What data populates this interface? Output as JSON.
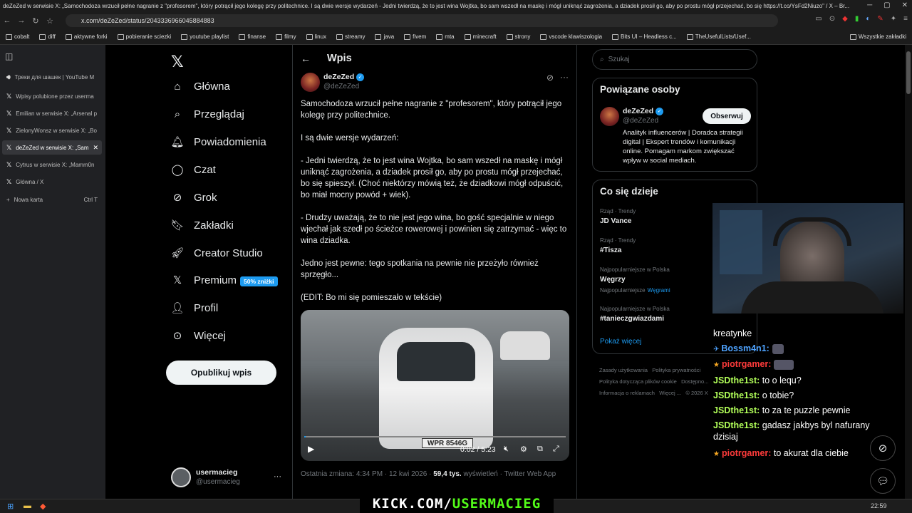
{
  "window": {
    "title": "deZeZed w serwisie X: „Samochodoza wrzucił pełne nagranie z \"profesorem\", który potrącił jego kolegę przy politechnice. I są dwie wersje wydarzeń - Jedni twierdzą, że to jest wina Wojtka, bo sam wszedł na maskę i mógł uniknąć zagrożenia, a dziadek prosił go, aby po prostu mógł przejechać, bo się https://t.co/YsFd2Niuzo\" / X – Br..."
  },
  "browser": {
    "url": "x.com/deZeZed/status/2043336966045884883"
  },
  "bookmarks": [
    "cobalt",
    "diff",
    "aktywne forki",
    "pobieranie sciezki",
    "youtube playlist",
    "finanse",
    "filmy",
    "linux",
    "streamy",
    "java",
    "fivem",
    "mta",
    "minecraft",
    "strony",
    "vscode klawiszologia",
    "Bits UI – Headless c...",
    "TheUsefulLists/Usef...",
    "Wszystkie zakładki"
  ],
  "tabs": [
    {
      "label": "Треки для шашек | YouTube M",
      "icon": "speaker-icon"
    },
    {
      "label": "Wpisy polubione przez userma",
      "icon": "x-logo"
    },
    {
      "label": "Emilian w serwisie X: „Arsenal p",
      "icon": "x-logo"
    },
    {
      "label": "ZielonyWonsz w serwisie X: „Bo",
      "icon": "x-logo"
    },
    {
      "label": "deZeZed w serwisie X: „Sam",
      "icon": "x-logo",
      "active": true
    },
    {
      "label": "Cytrus w serwisie X: „Mamm0n",
      "icon": "x-logo"
    },
    {
      "label": "Główna / X",
      "icon": "x-logo"
    }
  ],
  "new_tab": {
    "label": "Nowa karta",
    "shortcut": "Ctrl T"
  },
  "nav": [
    {
      "label": "Główna",
      "icon": "home-icon"
    },
    {
      "label": "Przeglądaj",
      "icon": "search-icon"
    },
    {
      "label": "Powiadomienia",
      "icon": "bell-icon"
    },
    {
      "label": "Czat",
      "icon": "chat-icon"
    },
    {
      "label": "Grok",
      "icon": "grok-icon"
    },
    {
      "label": "Zakładki",
      "icon": "bookmark-icon"
    },
    {
      "label": "Creator Studio",
      "icon": "rocket-icon"
    },
    {
      "label": "Premium",
      "icon": "x-logo"
    },
    {
      "label": "Profil",
      "icon": "person-icon"
    },
    {
      "label": "Więcej",
      "icon": "more-icon"
    }
  ],
  "premium_badge": "50% zniżki",
  "post_button": "Opublikuj wpis",
  "account": {
    "name": "usermacieg",
    "handle": "@usermacieg"
  },
  "header": {
    "title": "Wpis"
  },
  "post": {
    "author": "deZeZed",
    "handle": "@deZeZed",
    "paragraphs": [
      "Samochodoza wrzucił pełne nagranie z \"profesorem\", który potrącił jego kolegę przy politechnice.",
      "I są dwie wersje wydarzeń:",
      "- Jedni twierdzą, że to jest wina Wojtka, bo sam wszedł na maskę i mógł uniknąć zagrożenia, a dziadek prosił go, aby po prostu mógł przejechać, bo się spieszył. (Choć niektórzy mówią też, że dziadkowi mógł odpuścić, bo miał mocny powód + wiek).",
      "- Drudzy uważają, że to nie jest jego wina, bo gość specjalnie w niego wjechał jak szedł po ścieżce rowerowej i powinien się zatrzymać - więc to wina dziadka.",
      "Jedno jest pewne: tego spotkania na pewnie nie przeżyło również sprzęgło...",
      "(EDIT: Bo mi się pomieszało w tekście)"
    ],
    "video_time": "0:02 / 5:23",
    "plate": "WPR 8546G",
    "meta_prefix": "Ostatnia zmiana: 4:34 PM · 12 kwi 2026 · ",
    "views": "59,4 tys.",
    "meta_suffix": " wyświetleń · Twitter Web App"
  },
  "search": {
    "placeholder": "Szukaj"
  },
  "related": {
    "title": "Powiązane osoby",
    "name": "deZeZed",
    "handle": "@deZeZed",
    "follow": "Obserwuj",
    "bio": "Analityk influencerów | Doradca strategii digital | Ekspert trendów i komunikacji online. Pomagam markom zwiększać wpływ w social mediach."
  },
  "trends": {
    "title": "Co się dzieje",
    "items": [
      {
        "context": "Rząd · Trendy",
        "name": "JD Vance"
      },
      {
        "context": "Rząd · Trendy",
        "name": "#Tisza"
      },
      {
        "context": "Najpopularniejsze w Polska",
        "name": "Węgrzy",
        "extra_prefix": "Najpopularniejsze",
        "extra_link": "Węgrami"
      },
      {
        "context": "Najpopularniejsze w Polska",
        "name": "#tanieczgwiazdami"
      }
    ],
    "more": "Pokaż więcej"
  },
  "footer": [
    "Zasady użytkowania",
    "Polityka prywatności",
    "Polityka dotycząca plików cookie",
    "Dostępno...",
    "Informacja o reklamach",
    "Więcej ...",
    "© 2026 X"
  ],
  "chat": [
    {
      "user": "",
      "msg": "kreatynke",
      "color": "white"
    },
    {
      "user": "Bossm4n1:",
      "msg": "",
      "color": "blue",
      "badge": "✈"
    },
    {
      "user": "piotrgamer:",
      "msg": "",
      "color": "red",
      "badge": "★"
    },
    {
      "user": "JSDthe1st:",
      "msg": " to o lequ?",
      "color": "green"
    },
    {
      "user": "JSDthe1st:",
      "msg": " o tobie?",
      "color": "green"
    },
    {
      "user": "JSDthe1st:",
      "msg": " to za te puzzle pewnie",
      "color": "green"
    },
    {
      "user": "JSDthe1st:",
      "msg": " gadasz jakbys byl nafurany dzisiaj",
      "color": "green"
    },
    {
      "user": "piotrgamer:",
      "msg": " to akurat dla ciebie",
      "color": "red",
      "badge": "★"
    }
  ],
  "overlay": {
    "kick_prefix": "KICK.COM/",
    "kick_name": "USERMACIEG",
    "colors": {
      "kick_green": "#53fc18",
      "accent": "#1d9bf0"
    }
  },
  "taskbar": {
    "time": "22:59"
  }
}
